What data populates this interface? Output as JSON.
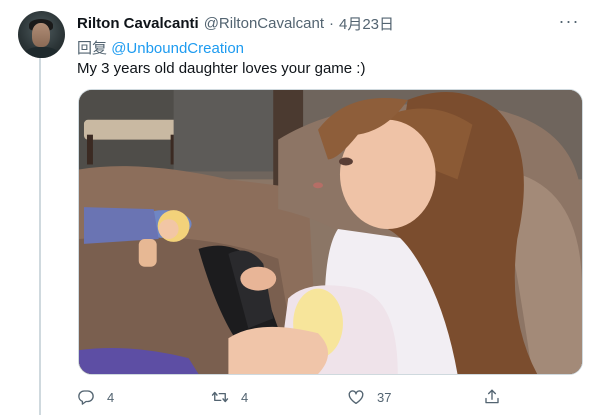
{
  "tweet": {
    "author_name": "Rilton Cavalcanti",
    "author_handle": "@RiltonCavalcant",
    "separator": "·",
    "date": "4月23日",
    "reply_prefix": "回复",
    "reply_to": "@UnboundCreation",
    "text": "My 3 years old daughter loves your game :)",
    "more_glyph": "···"
  },
  "actions": {
    "reply_count": "4",
    "retweet_count": "4",
    "like_count": "37"
  },
  "icons": {
    "reply": "reply-icon",
    "retweet": "retweet-icon",
    "like": "like-icon",
    "share": "share-icon",
    "more": "more-icon"
  },
  "colors": {
    "link": "#1d9bf0",
    "secondary_text": "#536471",
    "primary_text": "#0f1419",
    "thread_line": "#cfd9de"
  }
}
